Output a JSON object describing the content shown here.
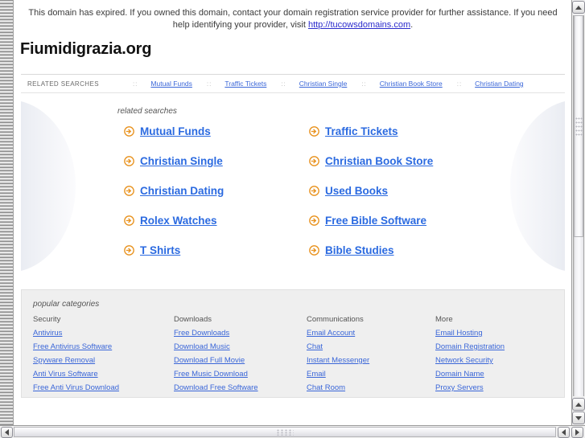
{
  "banner": {
    "text_before": "This domain has expired. If you owned this domain, contact your domain registration service provider for further assistance. If you need help identifying your provider, visit ",
    "link_text": "http://tucowsdomains.com",
    "text_after": "."
  },
  "page": {
    "domain_title": "Fiumidigrazia.org"
  },
  "topnav": {
    "label": "RELATED SEARCHES",
    "separator": "::",
    "items": [
      {
        "label": "Mutual Funds"
      },
      {
        "label": "Traffic Tickets"
      },
      {
        "label": "Christian Single"
      },
      {
        "label": "Christian Book Store"
      },
      {
        "label": "Christian Dating"
      }
    ]
  },
  "main": {
    "caption": "related searches",
    "bullet_icon": "arrow-circle-right-icon",
    "links": [
      {
        "label": "Mutual Funds"
      },
      {
        "label": "Traffic Tickets"
      },
      {
        "label": "Christian Single"
      },
      {
        "label": "Christian Book Store"
      },
      {
        "label": "Christian Dating"
      },
      {
        "label": "Used Books"
      },
      {
        "label": "Rolex Watches"
      },
      {
        "label": "Free Bible Software"
      },
      {
        "label": "T Shirts"
      },
      {
        "label": "Bible Studies"
      }
    ]
  },
  "categories": {
    "caption": "popular categories",
    "columns": [
      {
        "heading": "Security",
        "links": [
          "Antivirus",
          "Free Antivirus Software",
          "Spyware Removal",
          "Anti Virus Software",
          "Free Anti Virus Download"
        ]
      },
      {
        "heading": "Downloads",
        "links": [
          "Free Downloads",
          "Download Music",
          "Download Full Movie",
          "Free Music Download",
          "Download Free Software"
        ]
      },
      {
        "heading": "Communications",
        "links": [
          "Email Account",
          "Chat",
          "Instant Messenger",
          "Email",
          "Chat Room"
        ]
      },
      {
        "heading": "More",
        "links": [
          "Email Hosting",
          "Domain Registration",
          "Network Security",
          "Domain Name",
          "Proxy Servers"
        ]
      }
    ]
  },
  "colors": {
    "link_blue": "#3a66d8",
    "main_link_blue": "#2b6ae0",
    "bullet_orange": "#e8911c",
    "banner_link": "#2b2bcc",
    "categories_bg": "#efefef"
  },
  "scrollbars": {
    "vertical": {
      "up_icon": "triangle-up-icon",
      "down_icon": "triangle-down-icon",
      "grip_icon": "grip-dots-icon"
    },
    "horizontal": {
      "left_icon": "triangle-left-icon",
      "right_icon": "triangle-right-icon",
      "grip_icon": "grip-dots-icon"
    }
  }
}
